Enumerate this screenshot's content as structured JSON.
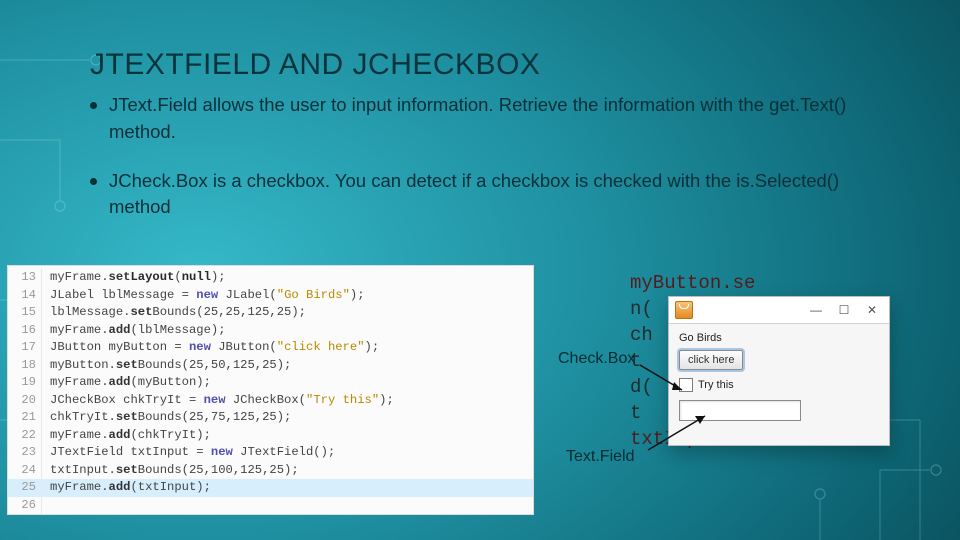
{
  "title": "JTEXTFIELD AND JCHECKBOX",
  "bullets": {
    "b1": "JText.Field allows the user to input information.  Retrieve the information with the get.Text() method.",
    "b2": "JCheck.Box is a checkbox.  You can detect if a checkbox is checked with the is.Selected() method"
  },
  "code": {
    "lines": [
      {
        "n": "13",
        "seg": [
          [
            "myFrame.",
            "p"
          ],
          [
            "set",
            "m"
          ],
          [
            "Layout",
            "b"
          ],
          [
            "(",
            "p"
          ],
          [
            "null",
            "b"
          ],
          [
            ");",
            "p"
          ]
        ]
      },
      {
        "n": "14",
        "seg": [
          [
            "JLabel lblMessage = ",
            "p"
          ],
          [
            "new",
            "kw"
          ],
          [
            " JLabel(",
            "p"
          ],
          [
            "\"Go Birds\"",
            "str"
          ],
          [
            ");",
            "p"
          ]
        ]
      },
      {
        "n": "15",
        "seg": [
          [
            "lblMessage.",
            "p"
          ],
          [
            "set",
            "m"
          ],
          [
            "Bounds(25,25,125,25);",
            "p"
          ]
        ]
      },
      {
        "n": "16",
        "seg": [
          [
            "myFrame.",
            "p"
          ],
          [
            "add",
            "m"
          ],
          [
            "(lblMessage);",
            "p"
          ]
        ]
      },
      {
        "n": "17",
        "seg": [
          [
            "JButton myButton = ",
            "p"
          ],
          [
            "new",
            "kw"
          ],
          [
            " JButton(",
            "p"
          ],
          [
            "\"click here\"",
            "str"
          ],
          [
            ");",
            "p"
          ]
        ]
      },
      {
        "n": "18",
        "seg": [
          [
            "myButton.",
            "p"
          ],
          [
            "set",
            "m"
          ],
          [
            "Bounds(25,50,125,25);",
            "p"
          ]
        ]
      },
      {
        "n": "19",
        "seg": [
          [
            "myFrame.",
            "p"
          ],
          [
            "add",
            "m"
          ],
          [
            "(myButton);",
            "p"
          ]
        ]
      },
      {
        "n": "20",
        "seg": [
          [
            "JCheckBox chkTryIt = ",
            "p"
          ],
          [
            "new",
            "kw"
          ],
          [
            " JCheckBox(",
            "p"
          ],
          [
            "\"Try this\"",
            "str"
          ],
          [
            ");",
            "p"
          ]
        ]
      },
      {
        "n": "21",
        "seg": [
          [
            "chkTryIt.",
            "p"
          ],
          [
            "set",
            "m"
          ],
          [
            "Bounds(25,75,125,25);",
            "p"
          ]
        ]
      },
      {
        "n": "22",
        "seg": [
          [
            "myFrame.",
            "p"
          ],
          [
            "add",
            "m"
          ],
          [
            "(chkTryIt);",
            "p"
          ]
        ]
      },
      {
        "n": "23",
        "seg": [
          [
            "JTextField txtInput = ",
            "p"
          ],
          [
            "new",
            "kw"
          ],
          [
            " JTextField();",
            "p"
          ]
        ]
      },
      {
        "n": "24",
        "seg": [
          [
            "txtInput.",
            "p"
          ],
          [
            "set",
            "m"
          ],
          [
            "Bounds(25,100,125,25);",
            "p"
          ]
        ]
      },
      {
        "n": "25",
        "seg": [
          [
            "myFrame.",
            "p"
          ],
          [
            "add",
            "m"
          ],
          [
            "(txtInput);",
            "p"
          ]
        ],
        "hl": true
      },
      {
        "n": "26",
        "seg": [
          [
            "",
            "p"
          ]
        ]
      }
    ]
  },
  "bgcode": {
    "l1": "myButton.se",
    "l2": "         n(",
    "l3": "         ch",
    "l4": "          t",
    "l5": "         d(",
    "l6": "          t",
    "l7": "txtInput.se"
  },
  "jwin": {
    "label": "Go Birds",
    "button": "click here",
    "checkbox": "Try this",
    "winbtns": {
      "min": "—",
      "max": "☐",
      "close": "✕"
    }
  },
  "anno": {
    "checkbox": "Check.Box",
    "textfield": "Text.Field"
  }
}
